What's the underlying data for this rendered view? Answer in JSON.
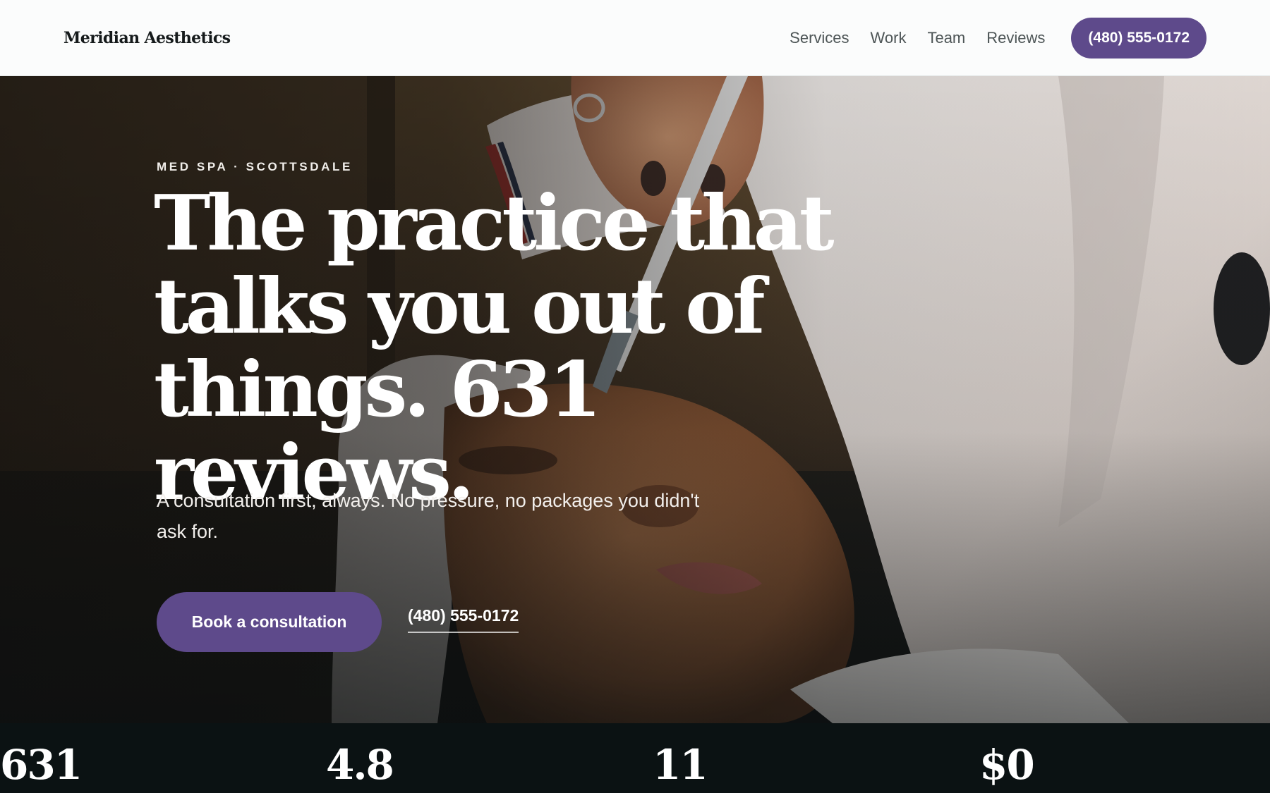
{
  "header": {
    "logo": "Meridian Aesthetics",
    "nav": [
      "Services",
      "Work",
      "Team",
      "Reviews"
    ],
    "cta": "(480) 555-0172"
  },
  "hero": {
    "eyebrow": "MED SPA · SCOTTSDALE",
    "headline": "The practice that talks you out of things. 631 reviews.",
    "subhead": "A consultation first, always. No pressure, no packages you didn't ask for.",
    "primary_button": "Book a consultation",
    "phone_link": "(480) 555-0172"
  },
  "stats": [
    "631",
    "4.8",
    "11",
    "$0"
  ],
  "colors": {
    "accent": "#5e4a8b",
    "header_bg": "#fbfcfc",
    "dark_bg": "#0b1213",
    "text_dark": "#151a1b",
    "nav_text": "#4d5556"
  }
}
